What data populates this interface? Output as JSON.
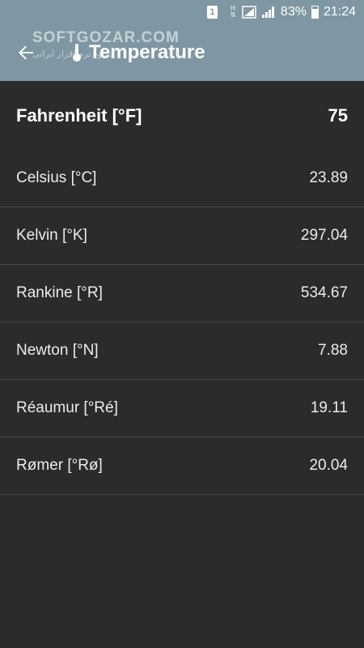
{
  "status_bar": {
    "notification": "1",
    "network": "H",
    "battery": "83%",
    "time": "21:24"
  },
  "app_bar": {
    "title": "Temperature",
    "back_icon": "arrow-left-icon",
    "title_icon": "thermometer-icon"
  },
  "watermark": {
    "text": "SOFTGOZAR.COM",
    "sub": "دانلود نرم افزار ایرانی"
  },
  "source": {
    "label": "Fahrenheit [°F]",
    "value": "75"
  },
  "conversions": [
    {
      "label": "Celsius [°C]",
      "value": "23.89"
    },
    {
      "label": "Kelvin [°K]",
      "value": "297.04"
    },
    {
      "label": "Rankine [°R]",
      "value": "534.67"
    },
    {
      "label": "Newton [°N]",
      "value": "7.88"
    },
    {
      "label": "Réaumur [°Ré]",
      "value": "19.11"
    },
    {
      "label": "Rømer [°Rø]",
      "value": "20.04"
    }
  ],
  "colors": {
    "app_bar": "#7e97a2",
    "background": "#2b2b2b",
    "divider": "#454545"
  }
}
